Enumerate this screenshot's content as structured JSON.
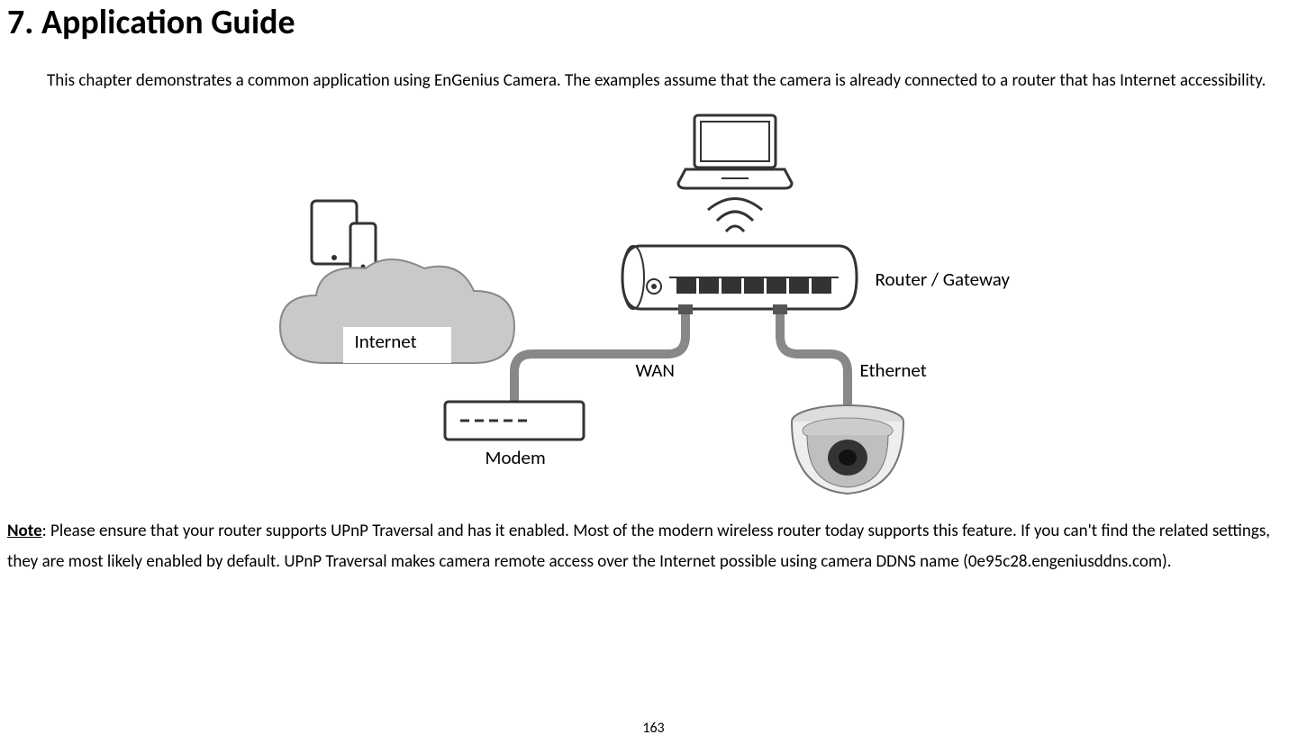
{
  "heading": "7. Application Guide",
  "intro": "This chapter demonstrates a common application using EnGenius Camera. The examples assume that the camera is already connected to a router that has Internet accessibility.",
  "diagram": {
    "labels": {
      "internet": "Internet",
      "modem": "Modem",
      "wan": "WAN",
      "ethernet": "Ethernet",
      "router": "Router / Gateway"
    }
  },
  "note": {
    "label": "Note",
    "text": ": Please ensure that your router supports UPnP Traversal and has it enabled. Most of the modern wireless router today supports this feature. If you can't find the related settings, they are most likely enabled by default. UPnP Traversal makes camera remote access over the Internet possible using camera DDNS name (0e95c28.engeniusddns.com)."
  },
  "page_number": "163"
}
